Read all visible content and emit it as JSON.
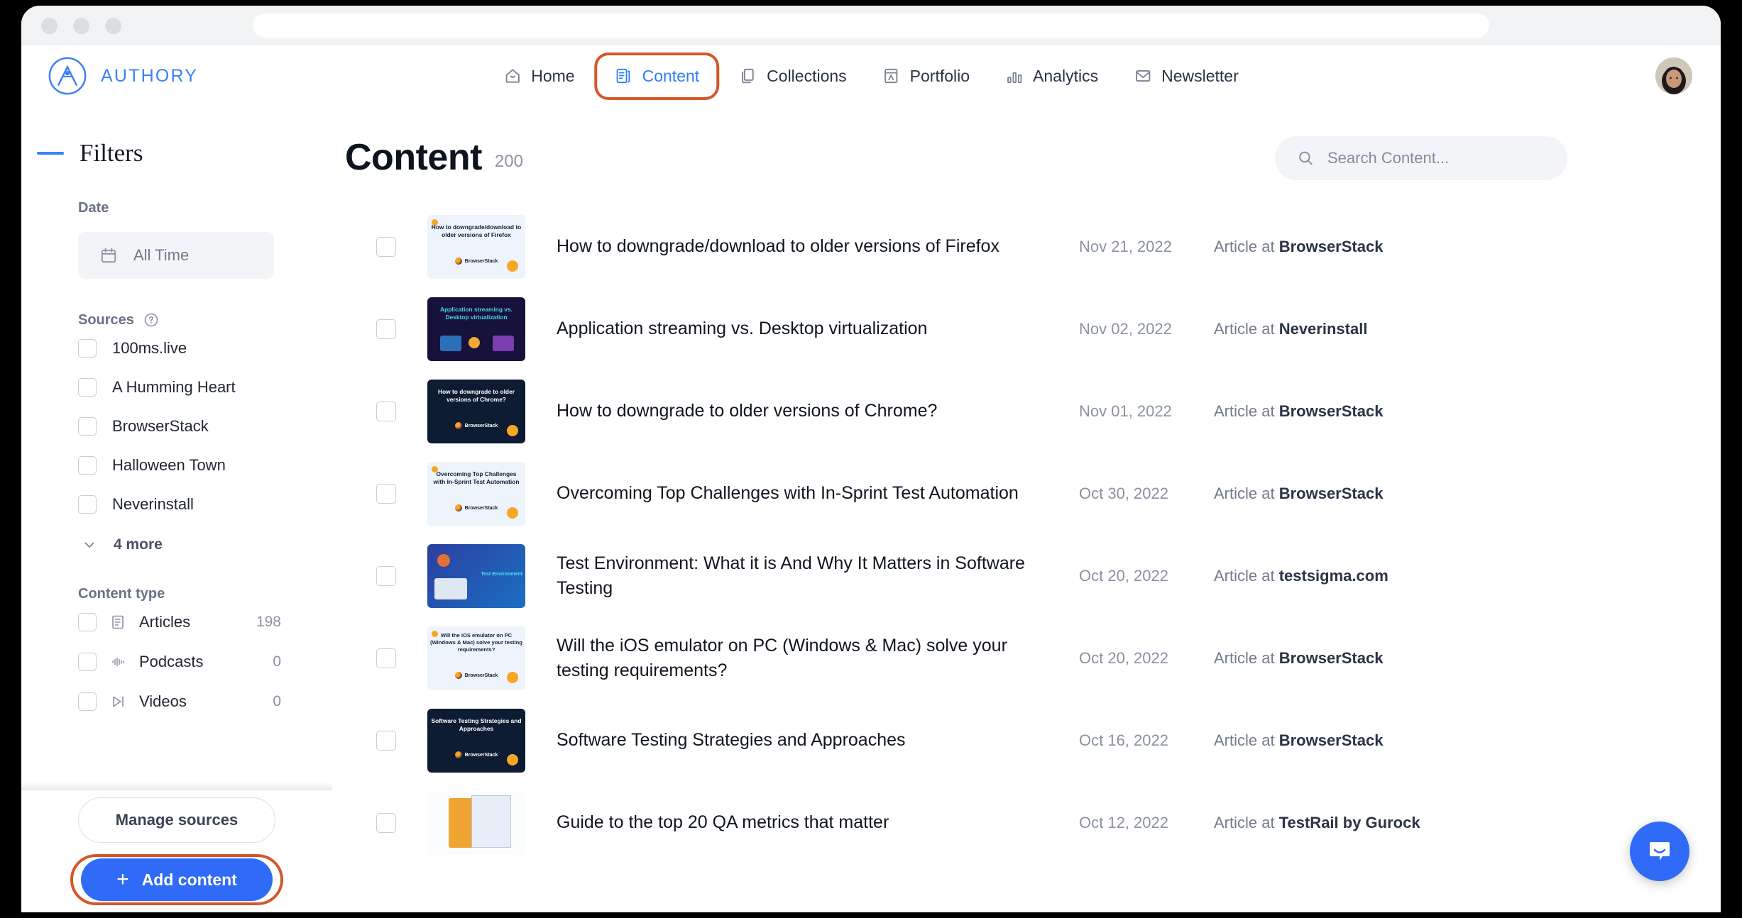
{
  "browser": {
    "url_value": ""
  },
  "brand": {
    "name": "AUTHORY"
  },
  "nav": {
    "items": [
      {
        "label": "Home",
        "icon": "home-icon",
        "active": false
      },
      {
        "label": "Content",
        "icon": "content-icon",
        "active": true
      },
      {
        "label": "Collections",
        "icon": "collections-icon",
        "active": false
      },
      {
        "label": "Portfolio",
        "icon": "portfolio-icon",
        "active": false
      },
      {
        "label": "Analytics",
        "icon": "analytics-icon",
        "active": false
      },
      {
        "label": "Newsletter",
        "icon": "newsletter-icon",
        "active": false
      }
    ]
  },
  "sidebar": {
    "title": "Filters",
    "date": {
      "label": "Date",
      "value": "All Time",
      "icon": "calendar-icon"
    },
    "sources": {
      "label": "Sources",
      "help_icon": "help-circle-icon",
      "items": [
        {
          "label": "100ms.live",
          "checked": false
        },
        {
          "label": "A Humming Heart",
          "checked": false
        },
        {
          "label": "BrowserStack",
          "checked": false
        },
        {
          "label": "Halloween Town",
          "checked": false
        },
        {
          "label": "Neverinstall",
          "checked": false
        }
      ],
      "more_label": "4 more",
      "more_icon": "chevron-down-icon"
    },
    "content_type": {
      "label": "Content type",
      "items": [
        {
          "label": "Articles",
          "count": "198",
          "icon": "article-icon"
        },
        {
          "label": "Podcasts",
          "count": "0",
          "icon": "podcast-icon"
        },
        {
          "label": "Videos",
          "count": "0",
          "icon": "video-icon"
        }
      ]
    },
    "manage_sources_label": "Manage sources",
    "add_content_label": "Add content",
    "add_content_plus": "+"
  },
  "main": {
    "title": "Content",
    "count": "200",
    "search": {
      "placeholder": "Search Content...",
      "value": "",
      "icon": "search-icon"
    },
    "rows": [
      {
        "title": "How to downgrade/download to older versions of Firefox",
        "date": "Nov 21, 2022",
        "source_prefix": "Article at ",
        "source": "BrowserStack",
        "thumb": {
          "style": "light",
          "text": "How to downgrade/download to older versions of Firefox",
          "brand": "BrowserStack"
        }
      },
      {
        "title": "Application streaming vs. Desktop virtualization",
        "date": "Nov 02, 2022",
        "source_prefix": "Article at ",
        "source": "Neverinstall",
        "thumb": {
          "style": "dark",
          "text": "Application streaming vs. Desktop virtualization",
          "brand": ""
        }
      },
      {
        "title": "How to downgrade to older versions of Chrome?",
        "date": "Nov 01, 2022",
        "source_prefix": "Article at ",
        "source": "BrowserStack",
        "thumb": {
          "style": "dark",
          "text": "How to downgrade to older versions of Chrome?",
          "brand": "BrowserStack"
        }
      },
      {
        "title": "Overcoming Top Challenges with In-Sprint Test Automation",
        "date": "Oct 30, 2022",
        "source_prefix": "Article at ",
        "source": "BrowserStack",
        "thumb": {
          "style": "light",
          "text": "Overcoming Top Challenges with In-Sprint Test Automation",
          "brand": "BrowserStack"
        }
      },
      {
        "title": "Test Environment: What it is And Why It Matters in Software Testing",
        "date": "Oct 20, 2022",
        "source_prefix": "Article at ",
        "source": "testsigma.com",
        "thumb": {
          "style": "dark",
          "text": "Test Environment",
          "brand": ""
        }
      },
      {
        "title": "Will the iOS emulator on PC (Windows & Mac) solve your testing requirements?",
        "date": "Oct 20, 2022",
        "source_prefix": "Article at ",
        "source": "BrowserStack",
        "thumb": {
          "style": "light",
          "text": "Will the iOS emulator on PC (Windows & Mac) solve your testing requirements?",
          "brand": "BrowserStack"
        }
      },
      {
        "title": "Software Testing Strategies and Approaches",
        "date": "Oct 16, 2022",
        "source_prefix": "Article at ",
        "source": "BrowserStack",
        "thumb": {
          "style": "dark",
          "text": "Software Testing Strategies and Approaches",
          "brand": "BrowserStack"
        }
      },
      {
        "title": "Guide to the top 20 QA metrics that matter",
        "date": "Oct 12, 2022",
        "source_prefix": "Article at ",
        "source": "TestRail by Gurock",
        "thumb": {
          "style": "light",
          "text": "",
          "brand": ""
        }
      }
    ]
  },
  "intercom": {
    "icon": "chat-bubble-icon"
  },
  "colors": {
    "brand_blue": "#3b82f6",
    "primary_blue": "#2f6bf6",
    "highlight_orange": "#d4572a",
    "text_dark": "#10161f",
    "text_muted": "#8a91a1"
  }
}
